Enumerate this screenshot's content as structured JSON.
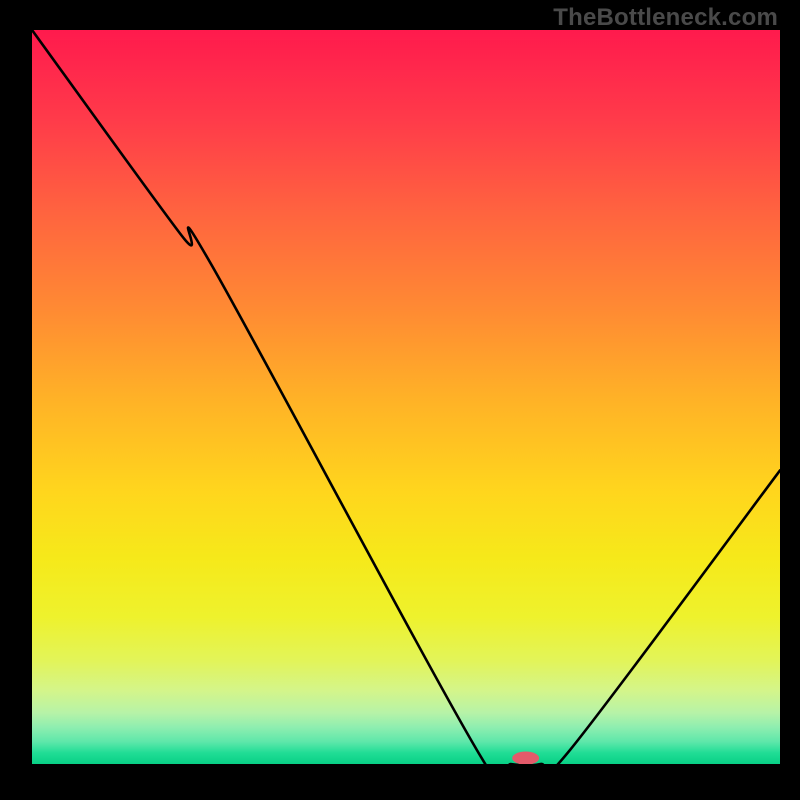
{
  "watermark": "TheBottleneck.com",
  "chart_data": {
    "type": "line",
    "title": "",
    "xlabel": "",
    "ylabel": "",
    "xlim": [
      0,
      100
    ],
    "ylim": [
      0,
      100
    ],
    "series": [
      {
        "name": "curve",
        "x": [
          0,
          20,
          24,
          60,
          64,
          68,
          72,
          100
        ],
        "values": [
          100,
          72,
          68,
          1,
          0,
          0,
          2,
          40
        ]
      }
    ],
    "marker": {
      "x": 66,
      "y": 0.8,
      "color": "#e35a6a",
      "rx": 1.8,
      "ry": 0.9
    },
    "colors": {
      "background_gradient": [
        "#ff1a4d",
        "#ffd61d",
        "#20dd95"
      ],
      "curve": "#000000",
      "frame": "#000000"
    }
  }
}
